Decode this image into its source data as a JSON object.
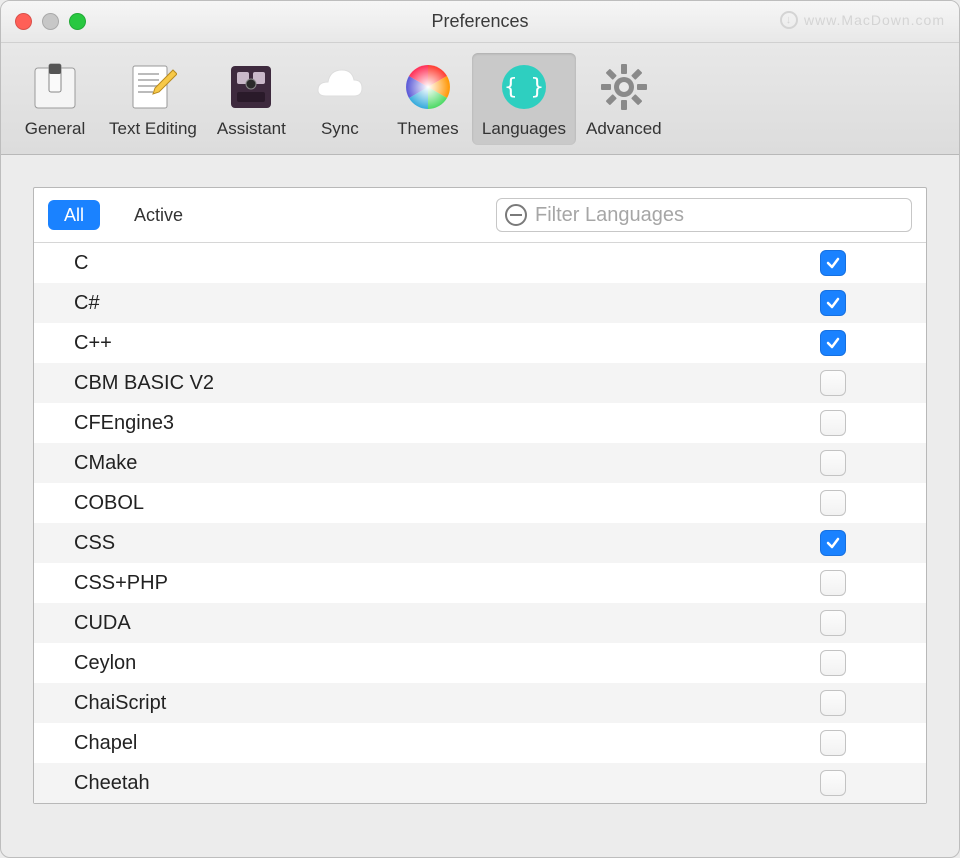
{
  "window": {
    "title": "Preferences",
    "watermark": "www.MacDown.com"
  },
  "toolbar": {
    "items": [
      {
        "id": "general",
        "label": "General"
      },
      {
        "id": "text-editing",
        "label": "Text Editing"
      },
      {
        "id": "assistant",
        "label": "Assistant"
      },
      {
        "id": "sync",
        "label": "Sync"
      },
      {
        "id": "themes",
        "label": "Themes"
      },
      {
        "id": "languages",
        "label": "Languages"
      },
      {
        "id": "advanced",
        "label": "Advanced"
      }
    ],
    "selected": "languages"
  },
  "filterbar": {
    "seg_all": "All",
    "seg_active": "Active",
    "placeholder": "Filter Languages"
  },
  "languages": [
    {
      "name": "C",
      "enabled": true
    },
    {
      "name": "C#",
      "enabled": true
    },
    {
      "name": "C++",
      "enabled": true
    },
    {
      "name": "CBM BASIC V2",
      "enabled": false
    },
    {
      "name": "CFEngine3",
      "enabled": false
    },
    {
      "name": "CMake",
      "enabled": false
    },
    {
      "name": "COBOL",
      "enabled": false
    },
    {
      "name": "CSS",
      "enabled": true
    },
    {
      "name": "CSS+PHP",
      "enabled": false
    },
    {
      "name": "CUDA",
      "enabled": false
    },
    {
      "name": "Ceylon",
      "enabled": false
    },
    {
      "name": "ChaiScript",
      "enabled": false
    },
    {
      "name": "Chapel",
      "enabled": false
    },
    {
      "name": "Cheetah",
      "enabled": false
    }
  ]
}
